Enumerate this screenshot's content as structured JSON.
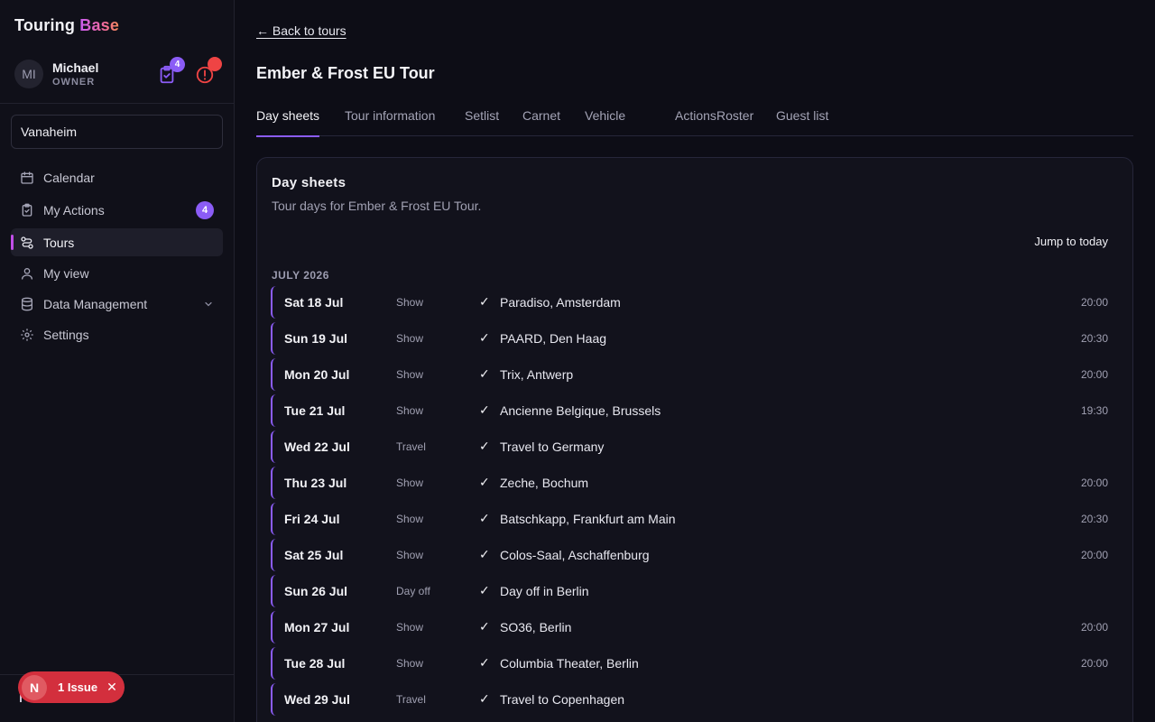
{
  "brand": {
    "part1": "Touring",
    "part2": "Base"
  },
  "user": {
    "initials": "MI",
    "name": "Michael",
    "role": "OWNER",
    "actions_count": "4"
  },
  "workspace": {
    "name": "Vanaheim"
  },
  "nav": {
    "items": [
      {
        "label": "Calendar",
        "icon": "calendar-icon"
      },
      {
        "label": "My Actions",
        "icon": "clipboard-check-icon",
        "badge": "4"
      },
      {
        "label": "Tours",
        "icon": "route-icon",
        "active": true
      },
      {
        "label": "My view",
        "icon": "user-icon"
      },
      {
        "label": "Data Management",
        "icon": "database-icon",
        "has_chevron": true
      },
      {
        "label": "Settings",
        "icon": "gear-icon"
      }
    ]
  },
  "issue_pill": {
    "letter": "N",
    "label": "1 Issue",
    "close": "✕"
  },
  "back_link": "← Back to tours",
  "tour_title": "Ember & Frost EU Tour",
  "tabs": [
    "Day sheets",
    "Tour information",
    "Setlist",
    "Carnet",
    "Vehicle",
    "Actions",
    "Roster",
    "Guest list"
  ],
  "card": {
    "title": "Day sheets",
    "subtitle": "Tour days for Ember & Frost EU Tour.",
    "jump_label": "Jump to today",
    "month": "JULY 2026",
    "check_glyph": "✓",
    "days": [
      {
        "date": "Sat 18 Jul",
        "type": "Show",
        "venue": "Paradiso, Amsterdam",
        "time": "20:00"
      },
      {
        "date": "Sun 19 Jul",
        "type": "Show",
        "venue": "PAARD, Den Haag",
        "time": "20:30"
      },
      {
        "date": "Mon 20 Jul",
        "type": "Show",
        "venue": "Trix, Antwerp",
        "time": "20:00"
      },
      {
        "date": "Tue 21 Jul",
        "type": "Show",
        "venue": "Ancienne Belgique, Brussels",
        "time": "19:30"
      },
      {
        "date": "Wed 22 Jul",
        "type": "Travel",
        "venue": "Travel to Germany",
        "time": ""
      },
      {
        "date": "Thu 23 Jul",
        "type": "Show",
        "venue": "Zeche, Bochum",
        "time": "20:00"
      },
      {
        "date": "Fri 24 Jul",
        "type": "Show",
        "venue": "Batschkapp, Frankfurt am Main",
        "time": "20:30"
      },
      {
        "date": "Sat 25 Jul",
        "type": "Show",
        "venue": "Colos-Saal, Aschaffenburg",
        "time": "20:00"
      },
      {
        "date": "Sun 26 Jul",
        "type": "Day off",
        "venue": "Day off in Berlin",
        "time": ""
      },
      {
        "date": "Mon 27 Jul",
        "type": "Show",
        "venue": "SO36, Berlin",
        "time": "20:00"
      },
      {
        "date": "Tue 28 Jul",
        "type": "Show",
        "venue": "Columbia Theater, Berlin",
        "time": "20:00"
      },
      {
        "date": "Wed 29 Jul",
        "type": "Travel",
        "venue": "Travel to Copenhagen",
        "time": ""
      }
    ]
  },
  "colors": {
    "accent": "#8b5cf6",
    "issue_red": "#d32f3d",
    "active_marker": "#c14ee8"
  }
}
